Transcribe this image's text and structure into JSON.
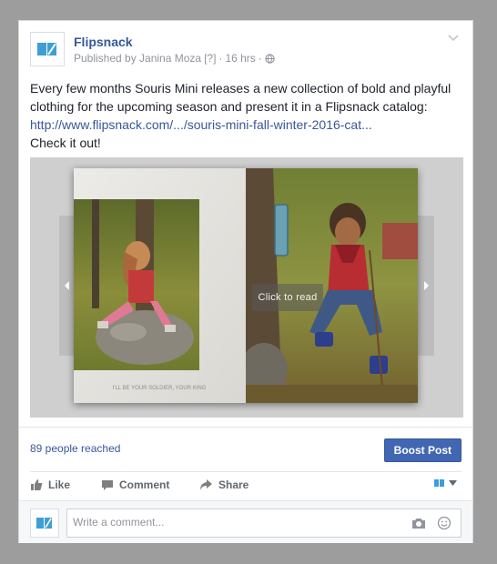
{
  "post": {
    "page_name": "Flipsnack",
    "published_by": "Published by Janina Moza",
    "help_badge": "[?]",
    "time": "16 hrs",
    "text_line1": "Every few months Souris Mini releases a new collection of bold and playful clothing for the upcoming season and present it in a Flipsnack catalog:",
    "link": "http://www.flipsnack.com/.../souris-mini-fall-winter-2016-cat...",
    "text_line2": "Check it out!"
  },
  "media": {
    "overlay_label": "Click to read",
    "caption": "I'LL BE YOUR SOLDIER, YOUR KING"
  },
  "stats": {
    "reached": "89 people reached",
    "boost_label": "Boost Post"
  },
  "actions": {
    "like": "Like",
    "comment": "Comment",
    "share": "Share"
  },
  "comment_box": {
    "placeholder": "Write a comment..."
  },
  "colors": {
    "link": "#365899",
    "boost": "#4267b2",
    "brand_icon": "#3d9fd6"
  }
}
